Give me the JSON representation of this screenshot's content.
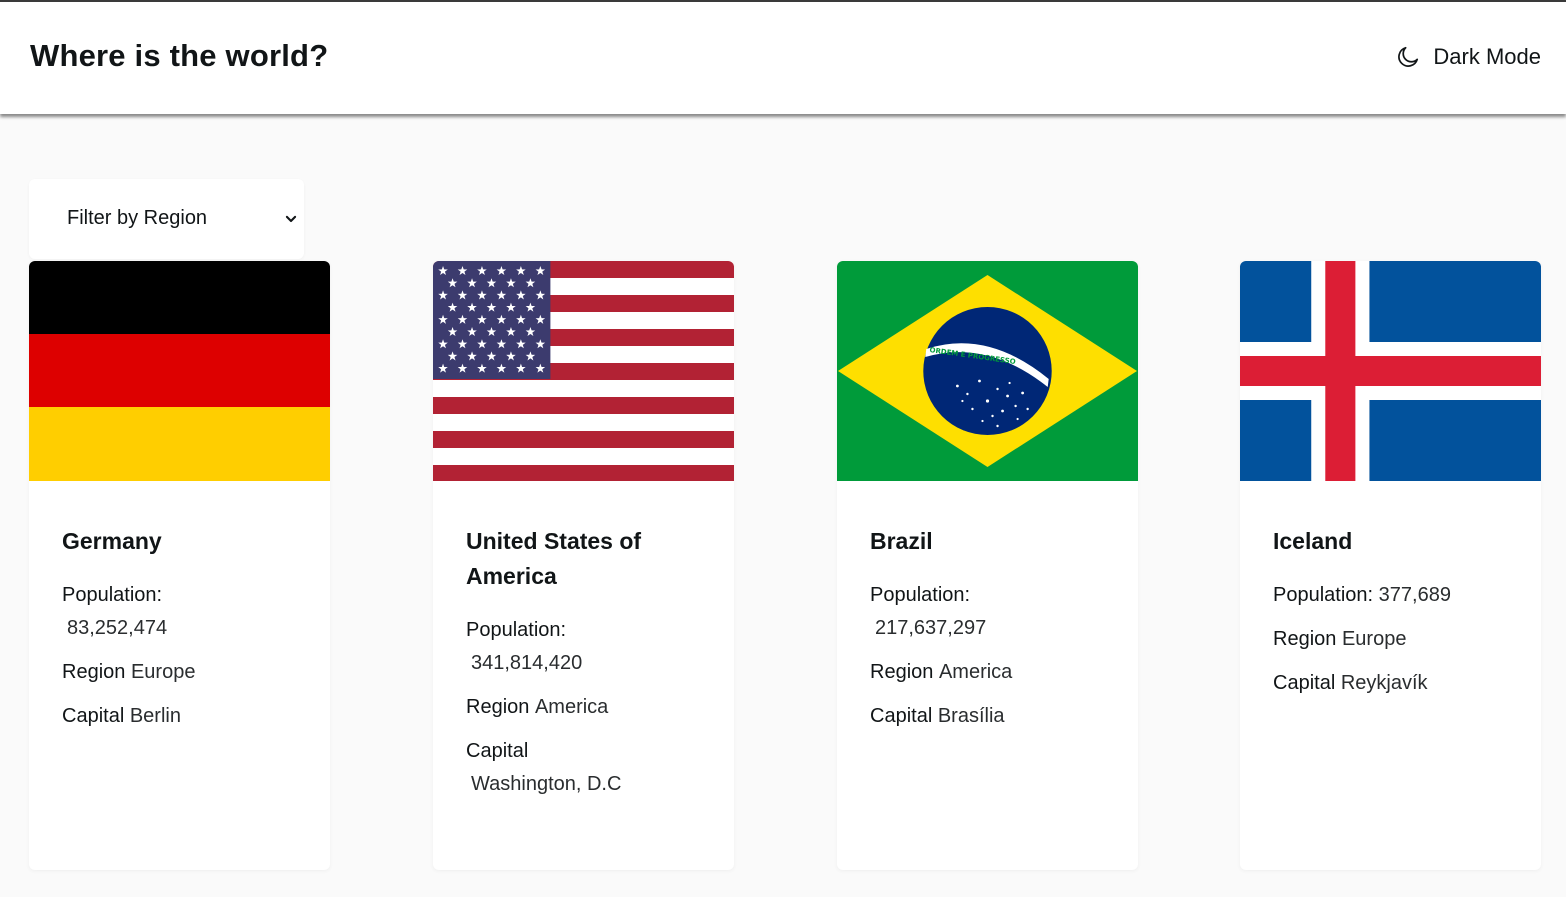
{
  "header": {
    "title": "Where is the world?",
    "theme_toggle_label": "Dark Mode",
    "theme_toggle_icon": "moon-icon"
  },
  "filter": {
    "placeholder": "Filter by Region",
    "icon": "chevron-down-icon"
  },
  "labels": {
    "population": "Population:",
    "region": "Region",
    "capital": "Capital"
  },
  "countries": [
    {
      "name": "Germany",
      "population": "83,252,474",
      "region": "Europe",
      "capital": "Berlin",
      "flag_icon": "germany-flag"
    },
    {
      "name": "United States of America",
      "population": "341,814,420",
      "region": "America",
      "capital": "Washington, D.C",
      "flag_icon": "usa-flag"
    },
    {
      "name": "Brazil",
      "population": "217,637,297",
      "region": "America",
      "capital": "Brasília",
      "flag_icon": "brazil-flag",
      "flag_motto": "ORDEM E PROGRESSO"
    },
    {
      "name": "Iceland",
      "population": "377,689",
      "region": "Europe",
      "capital": "Reykjavík",
      "flag_icon": "iceland-flag"
    }
  ]
}
